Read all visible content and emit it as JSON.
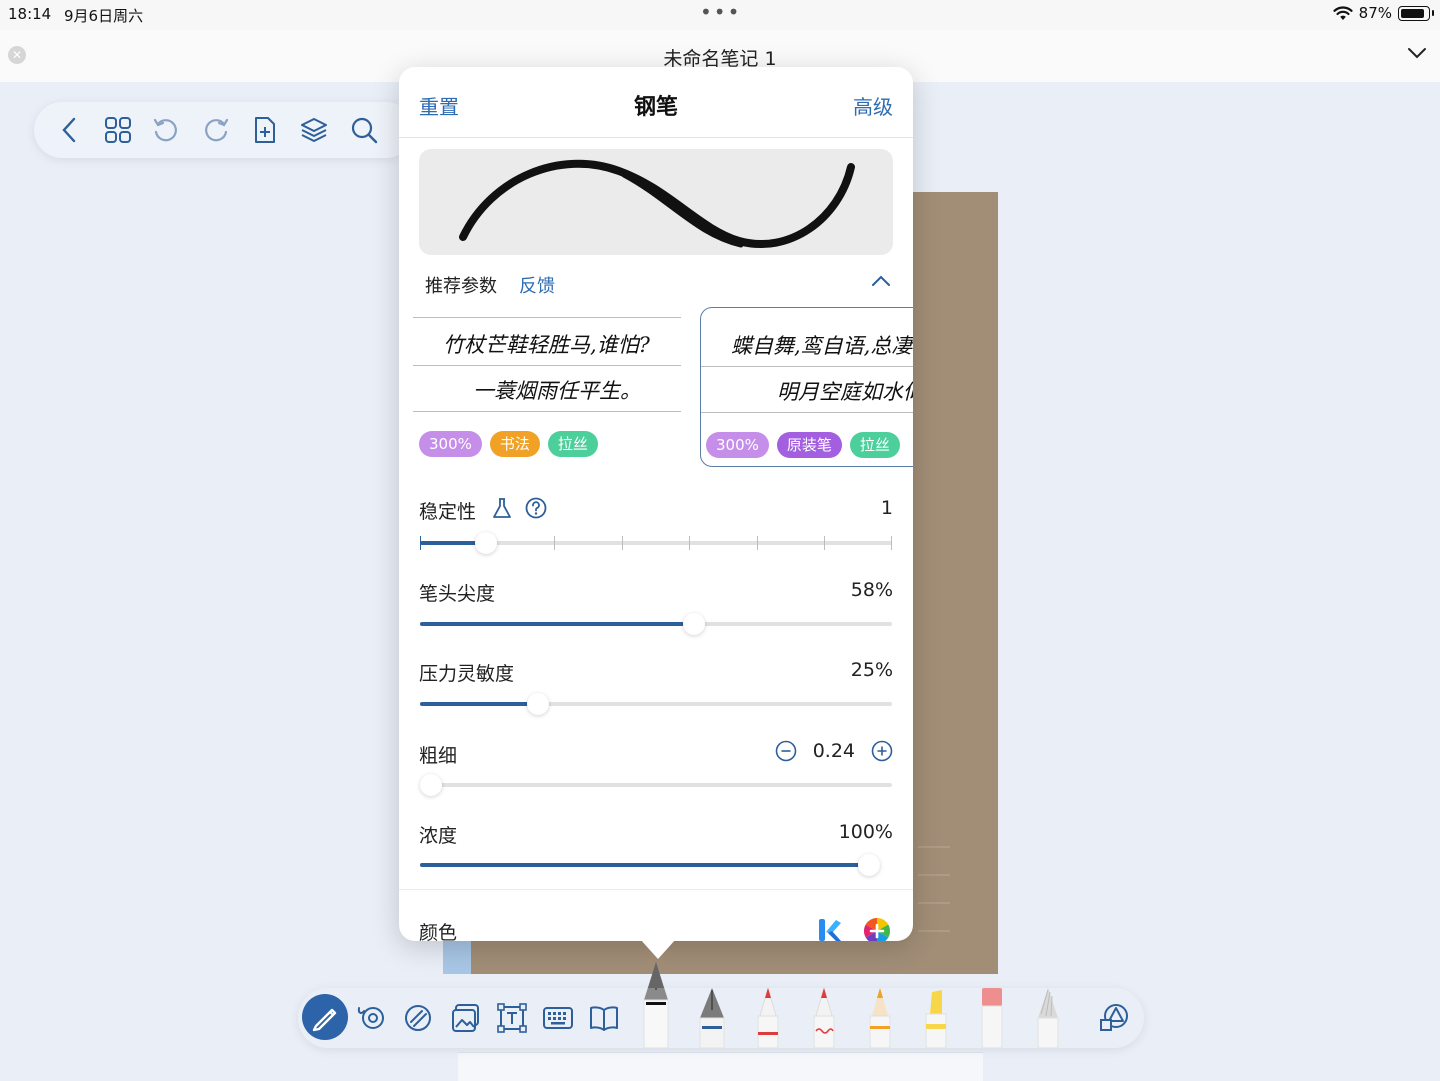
{
  "status_bar": {
    "time": "18:14",
    "date": "9月6日周六",
    "dots": "•••",
    "battery_percent": "87%"
  },
  "title_bar": {
    "title": "未命名笔记 1"
  },
  "pen_panel": {
    "reset_label": "重置",
    "title": "钢笔",
    "advanced_label": "高级",
    "recommended_label": "推荐参数",
    "feedback_label": "反馈",
    "presets": [
      {
        "line1": "竹杖芒鞋轻胜马,谁怕?",
        "line2": "一蓑烟雨任平生。",
        "tags": [
          "300%",
          "书法",
          "拉丝"
        ]
      },
      {
        "line1": "蝶自舞,鸾自语,总凄然。",
        "line2": "明月空庭如水似年",
        "tags": [
          "300%",
          "原装笔",
          "拉丝"
        ]
      }
    ],
    "sliders": {
      "stability": {
        "label": "稳定性",
        "value": "1",
        "level": 0.14
      },
      "tip_sharpness": {
        "label": "笔头尖度",
        "value": "58%",
        "level": 0.58
      },
      "pressure_sensitivity": {
        "label": "压力灵敏度",
        "value": "25%",
        "level": 0.25
      },
      "thickness": {
        "label": "粗细",
        "value": "0.24",
        "level": 0.0
      },
      "opacity": {
        "label": "浓度",
        "value": "100%",
        "level": 1.0
      }
    },
    "color_label": "颜色"
  },
  "colors": {
    "accent": "#2d63a8",
    "link": "#2d6bb3",
    "tag_purple_light": "#c58ee8",
    "tag_orange": "#f0a126",
    "tag_green": "#4ccf9b",
    "tag_purple": "#a35fe0",
    "notebook": "#a28e77"
  },
  "icons": {
    "top_toolbar": [
      "back-icon",
      "grid-icon",
      "undo-icon",
      "redo-icon",
      "add-page-icon",
      "layers-icon",
      "search-icon"
    ],
    "bottom_toolbar": [
      "pen-tool-icon",
      "lasso-icon",
      "eraser-icon",
      "image-icon",
      "text-box-icon",
      "keyboard-icon",
      "book-icon",
      "shapes-icon"
    ]
  }
}
